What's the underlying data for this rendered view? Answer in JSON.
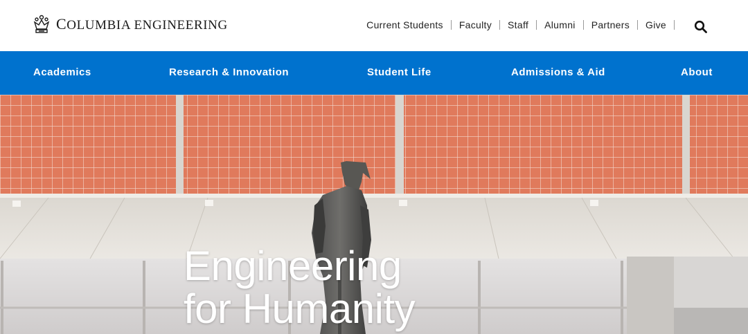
{
  "brand": {
    "name": "Columbia Engineering",
    "icon": "crown-icon"
  },
  "utility_nav": [
    {
      "label": "Current Students"
    },
    {
      "label": "Faculty"
    },
    {
      "label": "Staff"
    },
    {
      "label": "Alumni"
    },
    {
      "label": "Partners"
    },
    {
      "label": "Give"
    }
  ],
  "search": {
    "icon": "search-icon"
  },
  "main_nav": [
    {
      "label": "Academics"
    },
    {
      "label": "Research & Innovation"
    },
    {
      "label": "Student Life"
    },
    {
      "label": "Admissions & Aid"
    },
    {
      "label": "About"
    }
  ],
  "hero": {
    "headline_line1": "Engineering",
    "headline_line2": "for Humanity"
  },
  "colors": {
    "nav_blue": "#0072ce",
    "tile_orange": "#e07a5c",
    "text_dark": "#222222"
  }
}
